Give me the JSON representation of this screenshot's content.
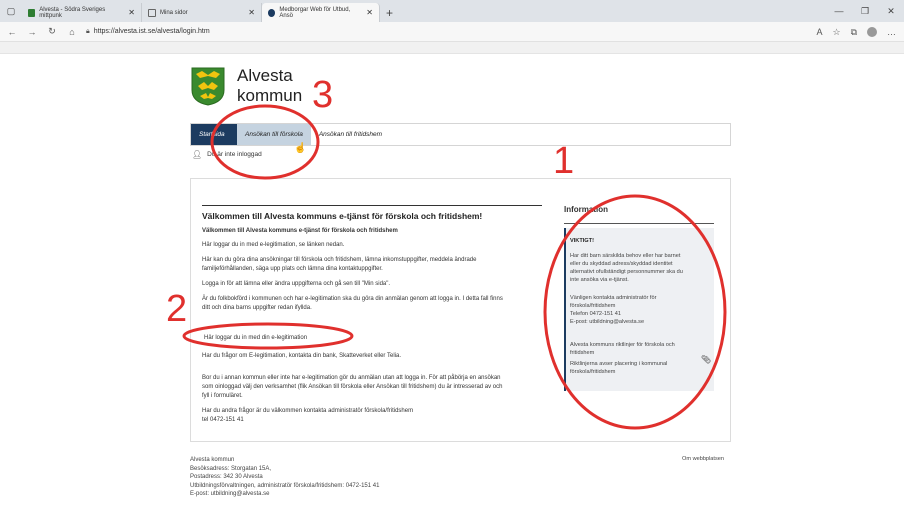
{
  "browser": {
    "tabs": [
      {
        "label": "Alvesta - Södra Sveriges mittpunk",
        "active": false
      },
      {
        "label": "Mina sidor",
        "active": false
      },
      {
        "label": "Medborgar Web för Utbud, Ansö",
        "active": true
      }
    ],
    "url": "https://alvesta.ist.se/alvesta/login.htm"
  },
  "brand": {
    "line1": "Alvesta",
    "line2": "kommun"
  },
  "nav": {
    "start": "Startsida",
    "application": "Ansökan till förskola",
    "fritids": "Ansökan till fritidshem"
  },
  "login_status": "Du är inte inloggad",
  "main": {
    "title": "Välkommen till Alvesta kommuns e-tjänst för förskola och fritidshem!",
    "subtitle": "Välkommen till Alvesta kommuns e-tjänst för förskola och fritidshem",
    "p1": "Här loggar du in med e-legitimation, se länken nedan.",
    "p2a": "Här kan du göra dina ansökningar till förskola och fritidshem, lämna inkomstuppgifter, meddela ändrade",
    "p2b": "familjeförhållanden, säga upp plats och lämna dina kontaktuppgifter.",
    "p3": "Logga in för att lämna eller ändra uppgifterna och gå sen till \"Min sida\".",
    "p4a": "Är du folkbokförd i kommunen och har e-legitimation ska du göra din anmälan genom att logga in. I detta fall finns",
    "p4b": "ditt och dina barns uppgifter redan ifyllda.",
    "login_link": "Här loggar du in med din e-legitimation",
    "p5": "Har du frågor om E-legitimation, kontakta din bank, Skatteverket eller Telia.",
    "p6a": "Bor du i annan kommun eller inte har e-legitimation gör du anmälan utan att logga in. För att påbörja en ansökan",
    "p6b": "som oinloggad välj den verksamhet (flik Ansökan till förskola eller Ansökan till fritidshem) du är intresserad av och",
    "p6c": "fyll i formuläret.",
    "p7": "Har du andra frågor är du välkommen kontakta administratör förskola/fritidshem",
    "p8": "tel 0472-151 41"
  },
  "info": {
    "heading": "Information",
    "important": "VIKTIGT!",
    "t1": "Har ditt barn särskilda behov eller har barnet",
    "t2": "eller du skyddad adress/skyddad identitet",
    "t3": "alternativt ofullständigt personnummer ska du",
    "t4": "inte ansöka via e-tjänst.",
    "t5": "Vänligen kontakta administratör för",
    "t6": "förskola/fritidshem",
    "t7": "Telefon 0472-151 41",
    "t8": "E-post: utbildning@alvesta.se",
    "t9": "Alvesta kommuns riktlinjer för förskola och",
    "t10": "fritidshem",
    "t11": "Riktlinjerna avser placering i kommunal",
    "t12": "förskola/fritidshem"
  },
  "footer": {
    "l1": "Alvesta kommun",
    "l2": "Besöksadress: Storgatan 15A,",
    "l3": "Postadress: 342 30 Alvesta",
    "l4": "Utbildningsförvaltningen, administratör förskola/fritidshem: 0472-151 41",
    "l5": "E-post: utbildning@alvesta.se",
    "about": "Om webbplatsen"
  },
  "annotations": {
    "a1": "1",
    "a2": "2",
    "a3": "3"
  },
  "colors": {
    "annotation": "#e0302d",
    "nav_dark": "#1c3b60",
    "nav_light": "#c5d3e0"
  }
}
